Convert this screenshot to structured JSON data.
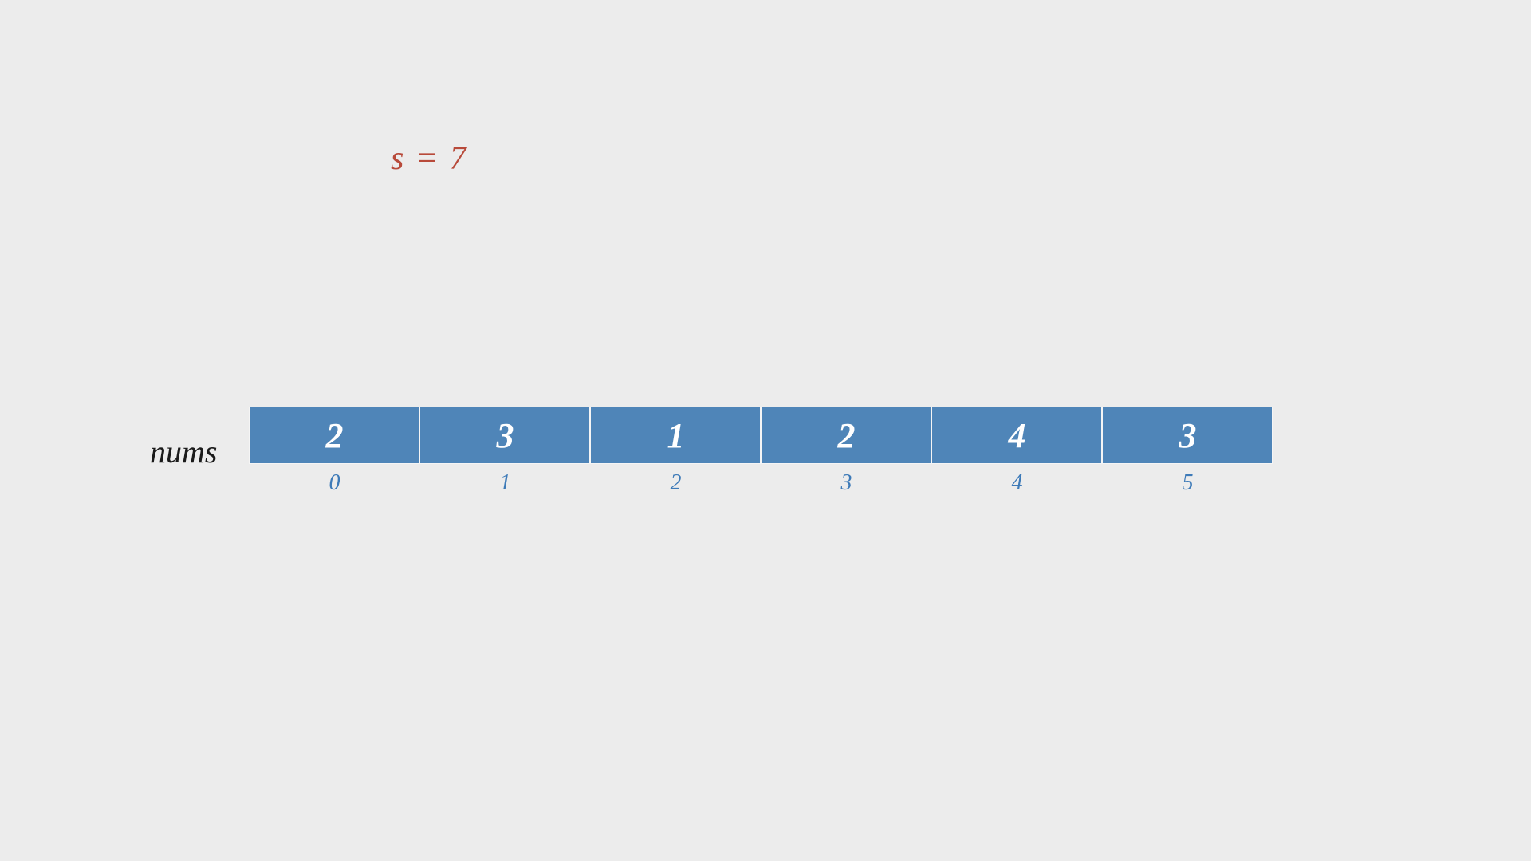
{
  "target": {
    "label": "s = 7"
  },
  "array": {
    "label": "nums",
    "cells": [
      {
        "value": "2",
        "index": "0"
      },
      {
        "value": "3",
        "index": "1"
      },
      {
        "value": "1",
        "index": "2"
      },
      {
        "value": "2",
        "index": "3"
      },
      {
        "value": "4",
        "index": "4"
      },
      {
        "value": "3",
        "index": "5"
      }
    ]
  }
}
